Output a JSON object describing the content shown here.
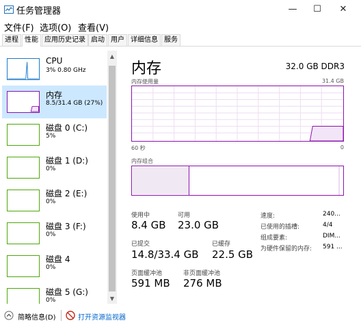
{
  "window": {
    "title": "任务管理器",
    "controls": {
      "minimize": "—",
      "maximize": "☐",
      "close": "✕"
    }
  },
  "menu": [
    "文件(F)",
    "选项(O)",
    "查看(V)"
  ],
  "tabs": [
    "进程",
    "性能",
    "应用历史记录",
    "启动",
    "用户",
    "详细信息",
    "服务"
  ],
  "active_tab": "性能",
  "sidebar": {
    "items": [
      {
        "title": "CPU",
        "sub": "3%  0.80 GHz",
        "color": "#1979ca",
        "selected": false
      },
      {
        "title": "内存",
        "sub": "8.5/31.4 GB (27%)",
        "color": "#8b12ae",
        "selected": true
      },
      {
        "title": "磁盘 0 (C:)",
        "sub": "5%",
        "color": "#4da60c",
        "selected": false
      },
      {
        "title": "磁盘 1 (D:)",
        "sub": "0%",
        "color": "#4da60c",
        "selected": false
      },
      {
        "title": "磁盘 2 (E:)",
        "sub": "0%",
        "color": "#4da60c",
        "selected": false
      },
      {
        "title": "磁盘 3 (F:)",
        "sub": "0%",
        "color": "#4da60c",
        "selected": false
      },
      {
        "title": "磁盘 4",
        "sub": "0%",
        "color": "#4da60c",
        "selected": false
      },
      {
        "title": "磁盘 5 (G:)",
        "sub": "0%",
        "color": "#4da60c",
        "selected": false
      }
    ]
  },
  "memory": {
    "title": "内存",
    "spec": "32.0 GB DDR3",
    "usage_label": "内存使用量",
    "usage_max": "31.4 GB",
    "time_left": "60 秒",
    "time_right": "0",
    "composition_label": "内存组合",
    "stats": {
      "in_use_label": "使用中",
      "in_use": "8.4 GB",
      "available_label": "可用",
      "available": "23.0 GB",
      "committed_label": "已提交",
      "committed": "14.8/33.4 GB",
      "cached_label": "已缓存",
      "cached": "22.5 GB",
      "paged_label": "页面缓冲池",
      "paged": "591 MB",
      "nonpaged_label": "非页面缓冲池",
      "nonpaged": "276 MB"
    },
    "details": [
      {
        "label": "速度:",
        "value": "240..."
      },
      {
        "label": "已使用的插槽:",
        "value": "4/4"
      },
      {
        "label": "组成要素:",
        "value": "DIM..."
      },
      {
        "label": "为硬件保留的内存:",
        "value": "591 ..."
      }
    ],
    "accent": "#8b12ae"
  },
  "footer": {
    "summary": "简略信息(D)",
    "monitor": "打开资源监视器",
    "link_color": "#0066cc"
  }
}
